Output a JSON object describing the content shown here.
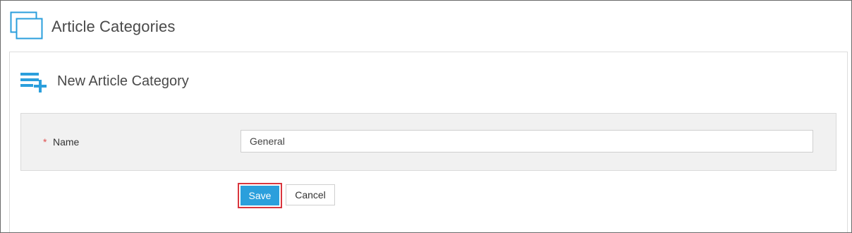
{
  "header": {
    "icon": "windows-stack-icon",
    "title": "Article Categories"
  },
  "card": {
    "icon": "list-add-icon",
    "title": "New Article Category"
  },
  "form": {
    "required_marker": "*",
    "name_label": "Name",
    "name_value": "General"
  },
  "actions": {
    "save_label": "Save",
    "cancel_label": "Cancel"
  },
  "colors": {
    "accent": "#2b9fdc",
    "highlight_border": "#d9363e",
    "required": "#e05050"
  }
}
